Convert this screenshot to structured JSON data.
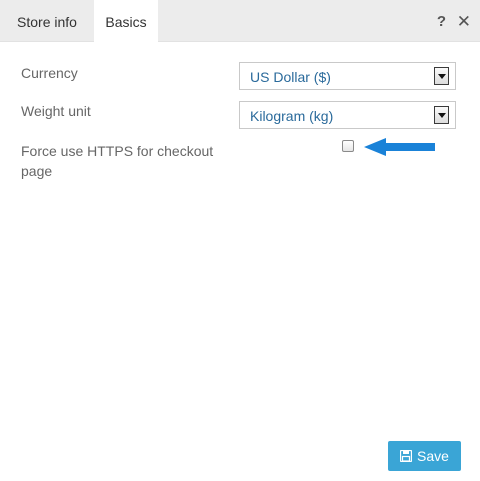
{
  "tabs": {
    "store_info": "Store info",
    "basics": "Basics",
    "active": "Basics"
  },
  "window_controls": {
    "help_glyph": "?",
    "close_glyph": "✕"
  },
  "form": {
    "currency": {
      "label": "Currency",
      "value": "US Dollar ($)"
    },
    "weight_unit": {
      "label": "Weight unit",
      "value": "Kilogram (kg)"
    },
    "force_https": {
      "label": "Force use HTTPS for checkout page",
      "checked": false
    }
  },
  "annotation": {
    "icon": "arrow-left-icon",
    "color": "#1a82d8"
  },
  "save_button": {
    "label": "Save",
    "icon": "floppy-disk-icon",
    "color": "#3aa5d6"
  }
}
